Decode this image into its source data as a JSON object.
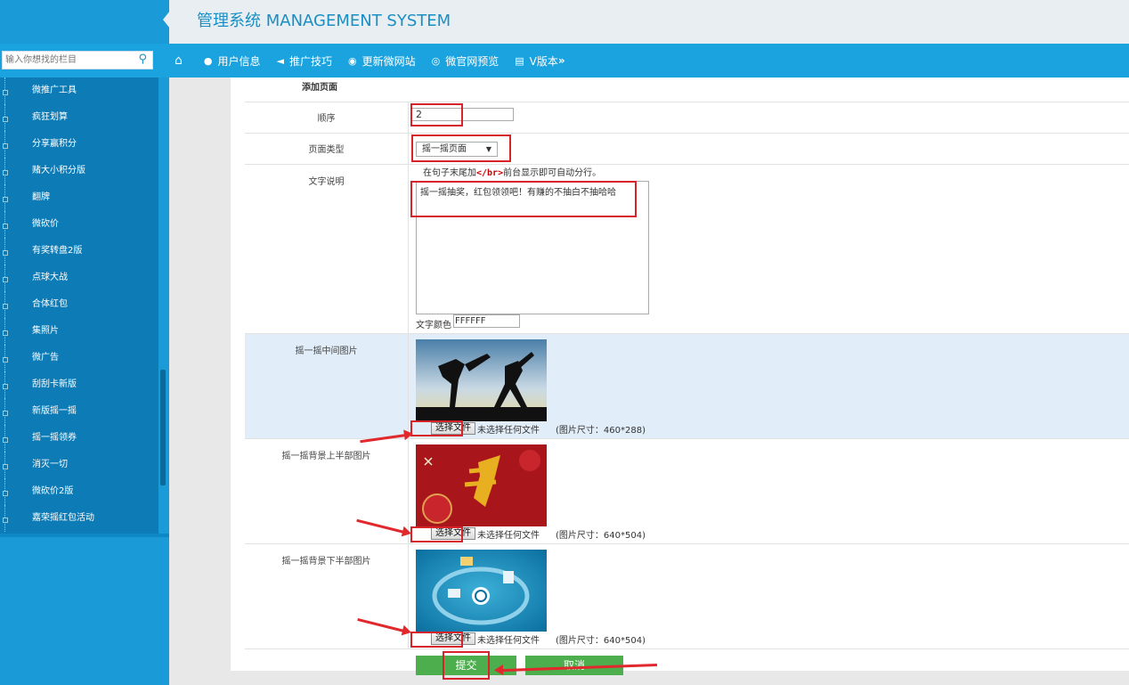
{
  "header": {
    "title": "管理系统 MANAGEMENT SYSTEM"
  },
  "search": {
    "placeholder": "输入你想找的栏目"
  },
  "nav": {
    "items": [
      {
        "label": "",
        "icon": "home-icon"
      },
      {
        "label": "用户信息",
        "icon": "user-icon"
      },
      {
        "label": "推广技巧",
        "icon": "megaphone-icon"
      },
      {
        "label": "更新微网站",
        "icon": "globe-icon"
      },
      {
        "label": "微官网预览",
        "icon": "eye-icon"
      },
      {
        "label": "V版本",
        "icon": "printer-icon"
      }
    ]
  },
  "sidebar": {
    "items": [
      "微推广工具",
      "疯狂划算",
      "分享赢积分",
      "赌大小积分版",
      "翻牌",
      "微砍价",
      "有奖转盘2版",
      "点球大战",
      "合体红包",
      "集照片",
      "微广告",
      "刮刮卡新版",
      "新版摇一摇",
      "摇一摇领券",
      "消灭一切",
      "微砍价2版",
      "嘉荣摇红包活动"
    ]
  },
  "form": {
    "section_title": "添加页面",
    "order_label": "顺序",
    "order_value": "2",
    "type_label": "页面类型",
    "type_value": "摇一摇页面",
    "desc_label": "文字说明",
    "desc_hint_prefix": "在句子末尾加",
    "desc_hint_code": "</br>",
    "desc_hint_suffix": "前台显示即可自动分行。",
    "desc_value": "摇一摇抽奖，红包领领吧！有赚的不抽白不抽哈哈",
    "color_label": "文字颜色",
    "color_value": "FFFFFF",
    "images": [
      {
        "label": "摇一摇中间图片",
        "button": "选择文件",
        "status": "未选择任何文件",
        "size": "(图片尺寸：460*288)"
      },
      {
        "label": "摇一摇背景上半部图片",
        "button": "选择文件",
        "status": "未选择任何文件",
        "size": "(图片尺寸：640*504)"
      },
      {
        "label": "摇一摇背景下半部图片",
        "button": "选择文件",
        "status": "未选择任何文件",
        "size": "(图片尺寸：640*504)"
      }
    ],
    "submit": "提交",
    "cancel": "取消"
  },
  "colors": {
    "accent": "#1aa3de",
    "sidebar": "#0d7cb6",
    "button": "#4cae4c",
    "annotation": "#d9232a"
  }
}
